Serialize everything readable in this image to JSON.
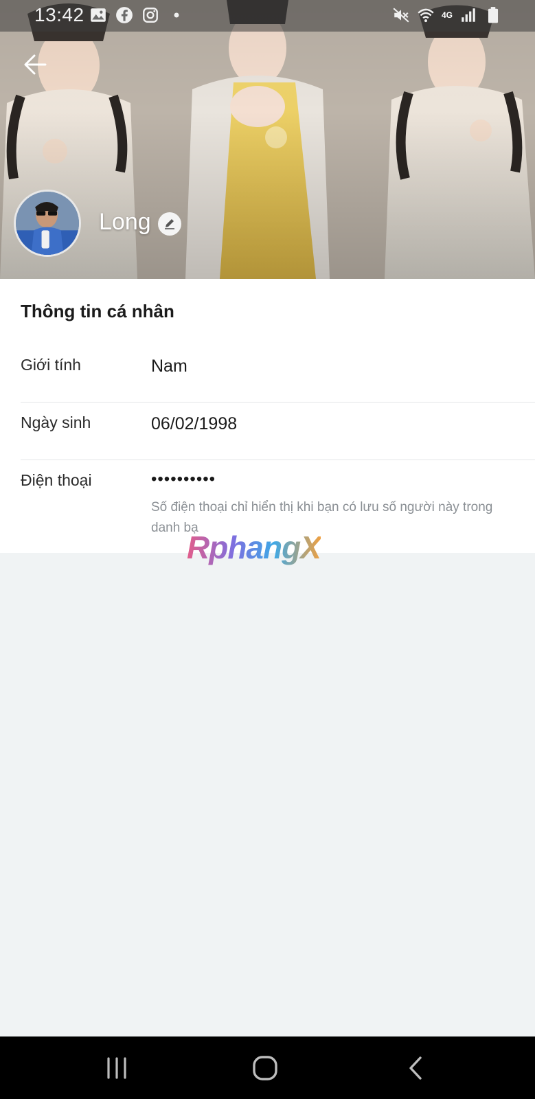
{
  "status_bar": {
    "time": "13:42",
    "left_icons": [
      "gallery-icon",
      "facebook-icon",
      "instagram-icon",
      "dot-icon"
    ],
    "right_icons": [
      "mute-icon",
      "wifi-icon",
      "4g-icon",
      "signal-icon",
      "battery-icon"
    ],
    "network_label": "4G"
  },
  "header": {
    "back_icon": "back-arrow-icon",
    "profile_name": "Long",
    "edit_icon": "pencil-icon"
  },
  "personal_info": {
    "title": "Thông tin cá nhân",
    "rows": [
      {
        "label": "Giới tính",
        "value": "Nam"
      },
      {
        "label": "Ngày sinh",
        "value": "06/02/1998"
      },
      {
        "label": "Điện thoại",
        "value": "••••••••••",
        "note": "Số điện thoại chỉ hiển thị khi bạn có lưu số người này trong danh bạ"
      }
    ]
  },
  "watermark": "RphangX",
  "nav_bar": {
    "recents_icon": "recents-icon",
    "home_icon": "home-icon",
    "back_icon": "nav-back-icon"
  },
  "colors": {
    "page_background": "#f0f3f4",
    "panel_background": "#ffffff",
    "nav_background": "#000000",
    "note_text": "#8a8f94"
  }
}
